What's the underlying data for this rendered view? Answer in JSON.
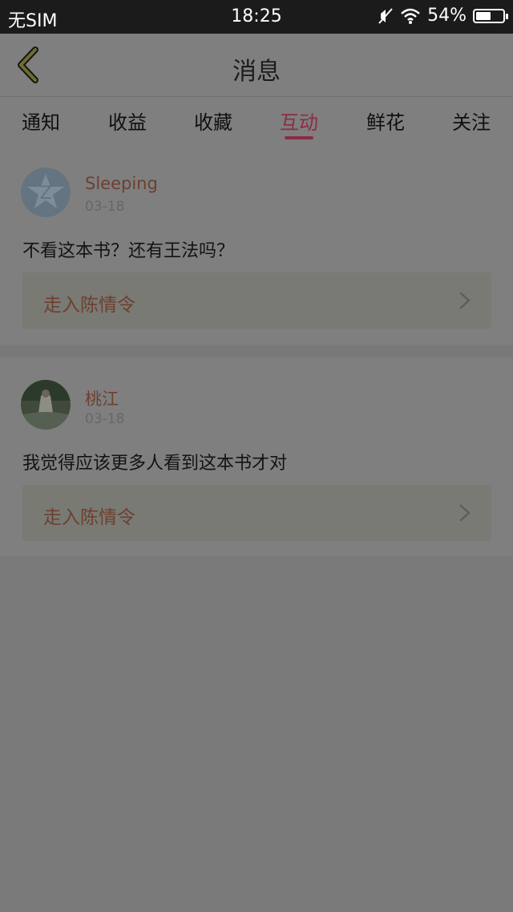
{
  "status_bar": {
    "carrier": "无SIM",
    "time": "18:25",
    "battery": "54%",
    "battery_level": 0.54
  },
  "header": {
    "title": "消息",
    "back_icon": "chevron-left-icon"
  },
  "tabs": [
    {
      "label": "通知",
      "active": false
    },
    {
      "label": "收益",
      "active": false
    },
    {
      "label": "收藏",
      "active": false
    },
    {
      "label": "互动",
      "active": true
    },
    {
      "label": "鲜花",
      "active": false
    },
    {
      "label": "关注",
      "active": false
    }
  ],
  "messages": [
    {
      "username": "Sleeping",
      "date": "03-18",
      "comment": "不看这本书？还有王法吗？",
      "book_link": "走入陈情令",
      "avatar_icon": "default-avatar-icon"
    },
    {
      "username": "桃江",
      "date": "03-18",
      "comment": "我觉得应该更多人看到这本书才对",
      "book_link": "走入陈情令",
      "avatar_icon": "user-photo-avatar"
    }
  ],
  "colors": {
    "accent": "#8a2d43",
    "username": "#6e3f2f",
    "status_bar_bg": "#1b1b1b",
    "overlay_bg": "#7f7f7f"
  }
}
